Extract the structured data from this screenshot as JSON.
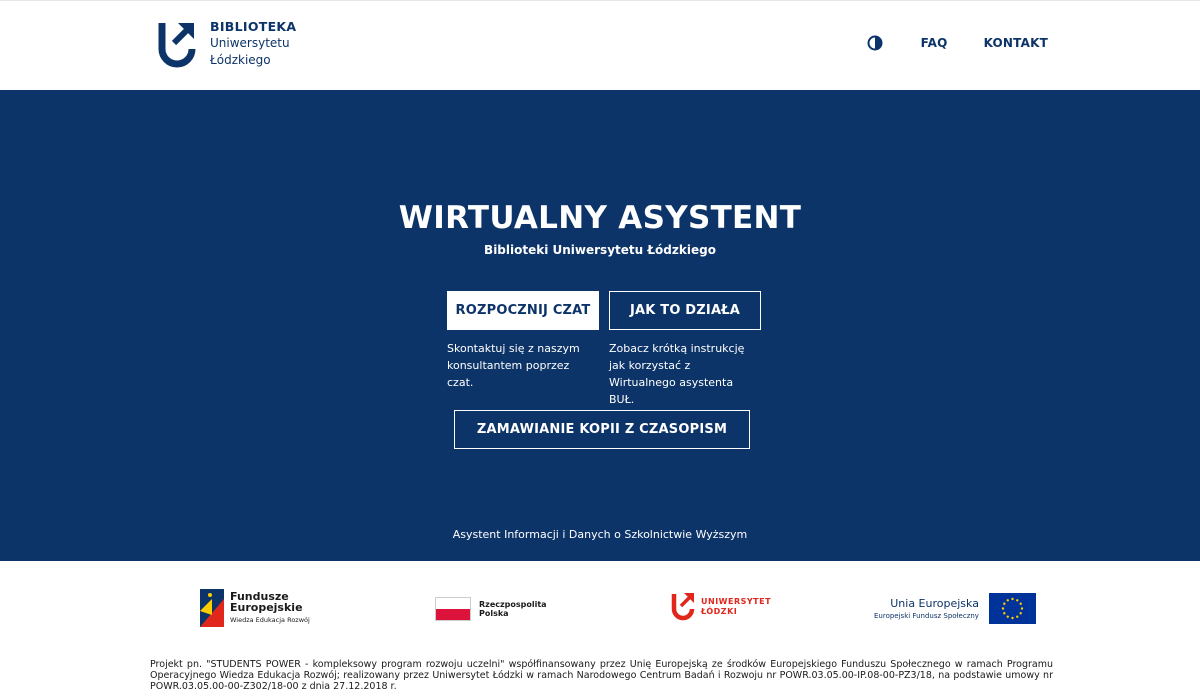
{
  "header": {
    "logo": {
      "line1": "BIBLIOTEKA",
      "line2": "Uniwersytetu",
      "line3": "Łódzkiego"
    },
    "nav": {
      "contrast_icon": "contrast-icon",
      "faq": "FAQ",
      "kontakt": "KONTAKT"
    }
  },
  "hero": {
    "title": "WIRTUALNY ASYSTENT",
    "subtitle": "Biblioteki Uniwersytetu Łódzkiego",
    "start_chat_label": "ROZPOCZNIJ CZAT",
    "start_chat_desc": "Skontaktuj się z naszym konsultantem poprzez czat.",
    "how_it_works_label": "JAK TO DZIAŁA",
    "how_it_works_desc": "Zobacz krótką instrukcję jak korzystać z Wirtualnego asystenta BUŁ.",
    "order_copies_label": "ZAMAWIANIE KOPII Z CZASOPISM",
    "footer_text": "Asystent Informacji i Danych o Szkolnictwie Wyższym"
  },
  "logos": {
    "fe_line1": "Fundusze",
    "fe_line2": "Europejskie",
    "fe_line3": "Wiedza Edukacja Rozwój",
    "rp_line1": "Rzeczpospolita",
    "rp_line2": "Polska",
    "ul_line1": "UNIWERSYTET",
    "ul_line2": "ŁÓDZKI",
    "ue_line1": "Unia Europejska",
    "ue_line2": "Europejski Fundusz Społeczny"
  },
  "project_note": "Projekt pn. \"STUDENTS POWER - kompleksowy program rozwoju uczelni\" współfinansowany przez Unię Europejską ze środków Europejskiego Funduszu Społecznego w ramach Programu Operacyjnego Wiedza Edukacja Rozwój; realizowany przez Uniwersytet Łódzki w ramach Narodowego Centrum Badań i Rozwoju nr POWR.03.05.00-IP.08-00-PZ3/18, na podstawie umowy nr POWR.03.05.00-00-Z302/18-00 z dnia 27.12.2018 r.",
  "colors": {
    "brand_navy": "#0d3468",
    "ul_red": "#e1261c",
    "pl_red": "#dc143c",
    "eu_blue": "#003399",
    "eu_yellow": "#ffcc00"
  }
}
